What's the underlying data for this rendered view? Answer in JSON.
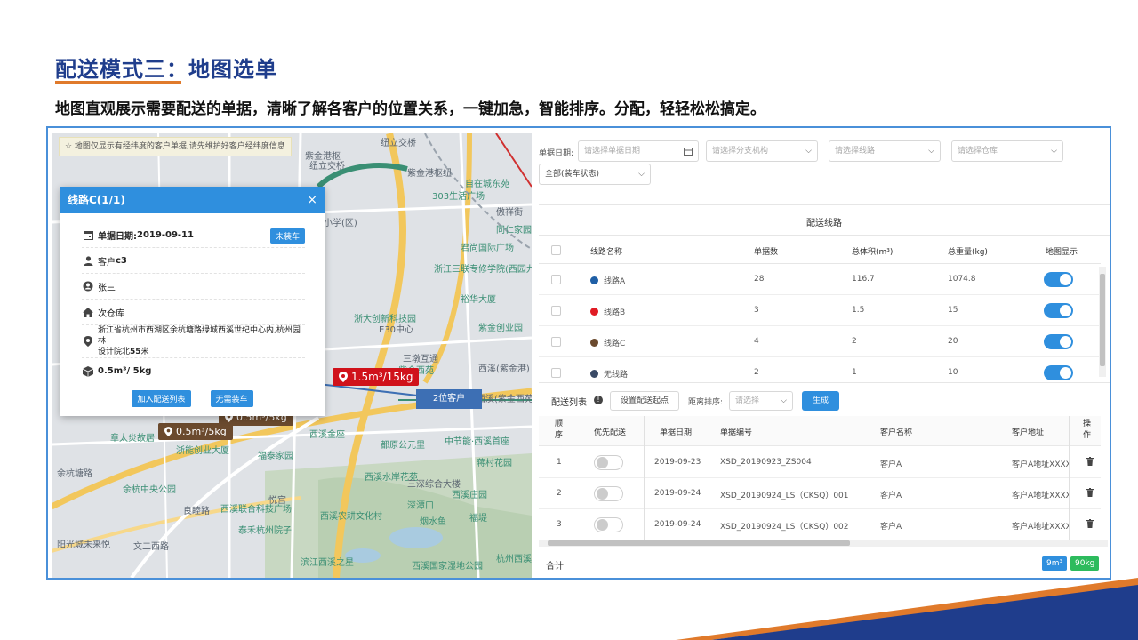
{
  "slide": {
    "title": "配送模式三：地图选单",
    "subtitle": "地图直观展示需要配送的单据，清晰了解各客户的位置关系，一键加急，智能排序。分配，轻轻松松搞定。"
  },
  "map": {
    "notice": "☆ 地图仅显示有经纬度的客户单据,请先维护好客户经纬度信息",
    "labels": [
      "纽立交桥",
      "紫金港枢",
      "纽立交桥",
      "紫金港枢纽",
      "自在城东苑",
      "303生活广场",
      "傲祥街",
      "君尚国际广场",
      "浙江三联专修学院(西园九路)",
      "裕华大厦",
      "浙大创新科技园",
      "E30中心",
      "紫金创业园",
      "三墩互通",
      "紫金西苑",
      "章太炎故居",
      "浙能创业大厦",
      "福泰家园",
      "都原公元里",
      "中节能·西溪首座",
      "蒋村花园",
      "余杭塘路",
      "余杭中央公园",
      "悦宫",
      "西溪金座",
      "西溪水岸花苑",
      "三深综合大楼",
      "深潭口",
      "西溪庄园",
      "西溪联合科技广场",
      "泰禾杭州院子",
      "西溪农耕文化村",
      "烟水鱼",
      "福堤",
      "阳光城未来悦",
      "文二西路",
      "滨江西溪之星",
      "西溪国家湿地公园",
      "杭州西溪湿地",
      "良睦路",
      "同仁家园",
      "西溪(紫金港)",
      "小学(区)",
      "西溪(紫金西苑)"
    ],
    "markers": {
      "red": "1.5m³/15kg",
      "brown1": "0.5m³/5kg",
      "brown2": "0.5m³/5kg",
      "blue": "2位客户"
    },
    "popup": {
      "title": "线路C(1/1)",
      "close": "×",
      "date_label": "单据日期:",
      "date_value": "2019-09-11",
      "status_tag": "未装车",
      "customer_prefix": "客户",
      "customer_value": "c3",
      "contact": "张三",
      "warehouse": "次仓库",
      "address_line1": "浙江省杭州市西湖区余杭塘路绿城西溪世纪中心内,杭州园林",
      "address_line2_prefix": "设计院北",
      "address_line2_bold": "55",
      "address_line2_suffix": "米",
      "volume_weight": "0.5m³/ 5kg",
      "btn_add": "加入配送列表",
      "btn_no_load": "无需装车"
    }
  },
  "filters": {
    "date_label": "单据日期:",
    "date_placeholder": "请选择单据日期",
    "branch_placeholder": "请选择分支机构",
    "route_placeholder": "请选择线路",
    "warehouse_placeholder": "请选择仓库",
    "status_value": "全部(装车状态)"
  },
  "routes": {
    "title": "配送线路",
    "headers": [
      "线路名称",
      "单据数",
      "总体积(m³)",
      "总重量(kg)",
      "地图显示"
    ],
    "rows": [
      {
        "name": "线路A",
        "color": "#1f5fa6",
        "count": "28",
        "volume": "116.7",
        "weight": "1074.8",
        "show": true
      },
      {
        "name": "线路B",
        "color": "#e01b24",
        "count": "3",
        "volume": "1.5",
        "weight": "15",
        "show": true
      },
      {
        "name": "线路C",
        "color": "#6b4a2e",
        "count": "4",
        "volume": "2",
        "weight": "20",
        "show": true
      },
      {
        "name": "无线路",
        "color": "#3a4a66",
        "count": "2",
        "volume": "1",
        "weight": "10",
        "show": true
      }
    ]
  },
  "delivery": {
    "label": "配送列表",
    "info_icon": "!",
    "set_start": "设置配送起点",
    "sort_label": "距离排序:",
    "sort_placeholder": "请选择",
    "generate": "生成",
    "headers": [
      "顺序",
      "优先配送",
      "单据日期",
      "单据编号",
      "客户名称",
      "客户地址",
      "操作"
    ],
    "rows": [
      {
        "seq": "1",
        "date": "2019-09-23",
        "code": "XSD_20190923_ZS004",
        "customer": "客户A",
        "address": "客户A地址XXXX"
      },
      {
        "seq": "2",
        "date": "2019-09-24",
        "code": "XSD_20190924_LS（CKSQ）001",
        "customer": "客户A",
        "address": "客户A地址XXXX"
      },
      {
        "seq": "3",
        "date": "2019-09-24",
        "code": "XSD_20190924_LS（CKSQ）002",
        "customer": "客户A",
        "address": "客户A地址XXXX"
      }
    ],
    "total_label": "合计",
    "total_volume": "9m³",
    "total_weight": "90kg"
  }
}
